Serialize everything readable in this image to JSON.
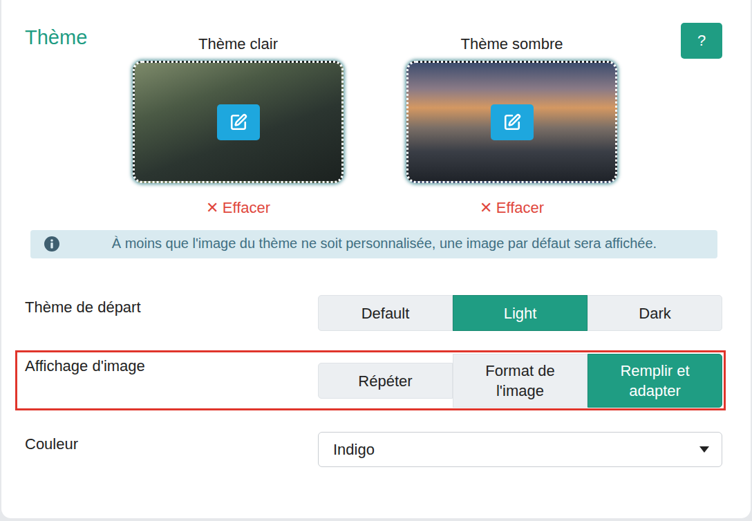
{
  "title": "Thème",
  "help": "?",
  "themes": [
    {
      "label": "Thème clair",
      "clear_icon": "✕",
      "clear_label": "Effacer"
    },
    {
      "label": "Thème sombre",
      "clear_icon": "✕",
      "clear_label": "Effacer"
    }
  ],
  "info": "À moins que l'image du thème ne soit personnalisée, une image par défaut sera affichée.",
  "start_theme": {
    "label": "Thème de départ",
    "highlighted": false,
    "options": [
      {
        "label": "Default",
        "selected": false
      },
      {
        "label": "Light",
        "selected": true
      },
      {
        "label": "Dark",
        "selected": false
      }
    ]
  },
  "image_display": {
    "label": "Affichage d'image",
    "highlighted": true,
    "options": [
      {
        "label": "Répéter",
        "selected": false
      },
      {
        "label": "Format de l'image",
        "selected": false
      },
      {
        "label": "Remplir et adapter",
        "selected": true
      }
    ]
  },
  "color": {
    "label": "Couleur",
    "value": "Indigo"
  }
}
